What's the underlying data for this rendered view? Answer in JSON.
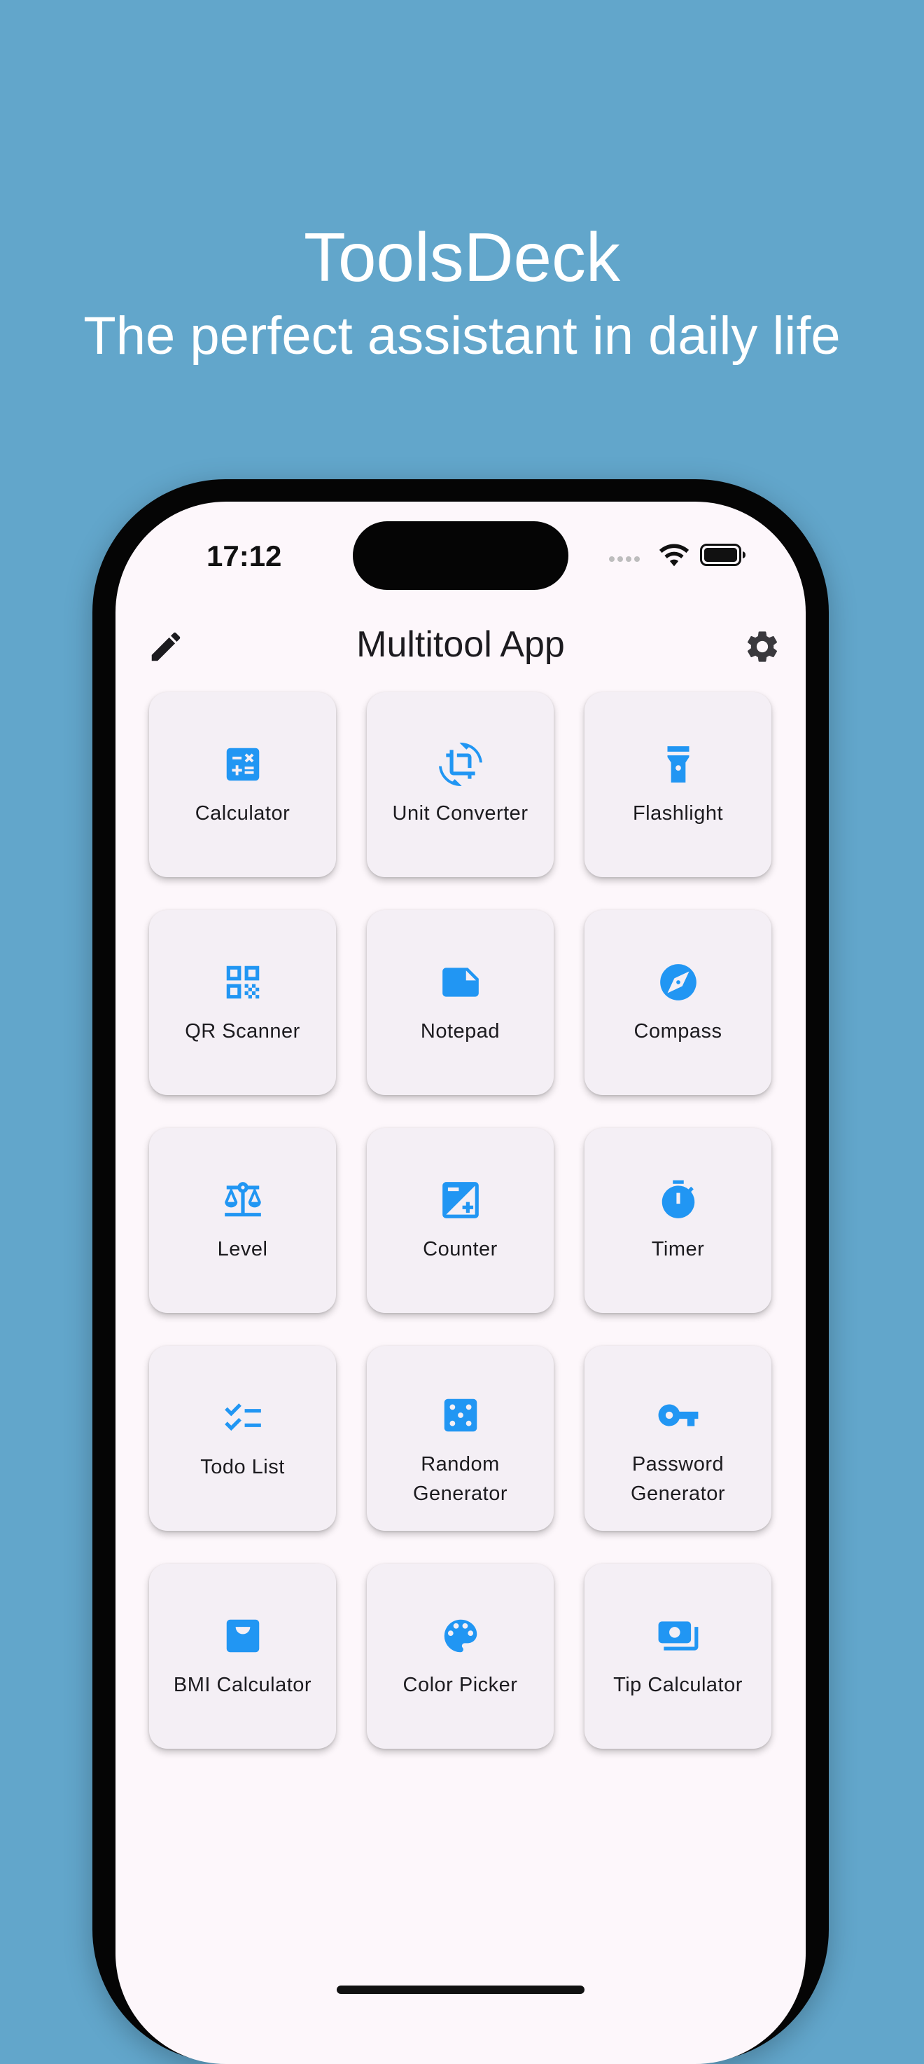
{
  "promo": {
    "title": "ToolsDeck",
    "subtitle": "The perfect assistant in daily life"
  },
  "status_bar": {
    "time": "17:12"
  },
  "app_bar": {
    "title": "Multitool App",
    "left_icon": "edit-icon",
    "right_icon": "gear-icon"
  },
  "accent_color": "#2196f3",
  "tools": [
    {
      "label": "Calculator",
      "icon": "calculator-icon"
    },
    {
      "label": "Unit Converter",
      "icon": "crop-rotate-icon"
    },
    {
      "label": "Flashlight",
      "icon": "flashlight-icon"
    },
    {
      "label": "QR Scanner",
      "icon": "qr-code-icon"
    },
    {
      "label": "Notepad",
      "icon": "note-icon"
    },
    {
      "label": "Compass",
      "icon": "compass-icon"
    },
    {
      "label": "Level",
      "icon": "balance-scale-icon"
    },
    {
      "label": "Counter",
      "icon": "exposure-icon"
    },
    {
      "label": "Timer",
      "icon": "stopwatch-icon"
    },
    {
      "label": "Todo List",
      "icon": "checklist-icon"
    },
    {
      "label": "Random\nGenerator",
      "icon": "dice-icon"
    },
    {
      "label": "Password\nGenerator",
      "icon": "key-icon"
    },
    {
      "label": "BMI Calculator",
      "icon": "monitor-weight-icon"
    },
    {
      "label": "Color Picker",
      "icon": "palette-icon"
    },
    {
      "label": "Tip Calculator",
      "icon": "payments-icon"
    }
  ]
}
